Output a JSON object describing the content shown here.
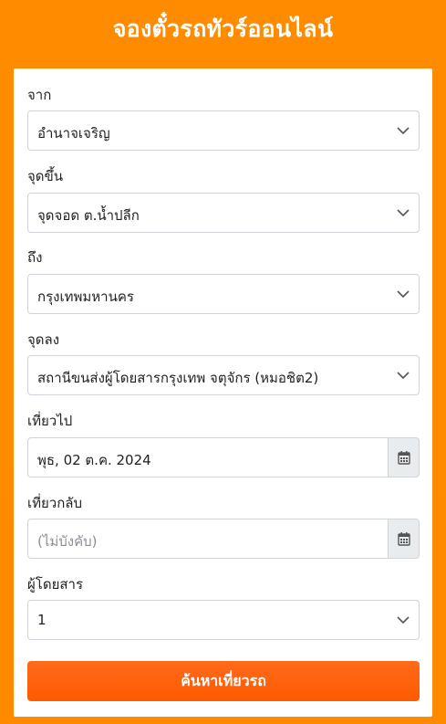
{
  "header": {
    "title": "จองตั๋วรถทัวร์ออนไลน์"
  },
  "form": {
    "from": {
      "label": "จาก",
      "value": "อำนาจเจริญ"
    },
    "pickup": {
      "label": "จุดขึ้น",
      "value": "จุดจอด ต.น้ำปลีก"
    },
    "to": {
      "label": "ถึง",
      "value": "กรุงเทพมหานคร"
    },
    "dropoff": {
      "label": "จุดลง",
      "value": "สถานีขนส่งผู้โดยสารกรุงเทพ จตุจักร (หมอชิต2)"
    },
    "depart": {
      "label": "เที่ยวไป",
      "value": "พุธ, 02 ต.ค. 2024"
    },
    "return": {
      "label": "เที่ยวกลับ",
      "placeholder": "(ไม่บังคับ)"
    },
    "passengers": {
      "label": "ผู้โดยสาร",
      "value": "1"
    },
    "search_label": "ค้นหาเที่ยวรถ"
  },
  "icons": {
    "dropdown": "chevron-down-icon",
    "calendar": "calendar-icon"
  },
  "colors": {
    "background": "#ff8c00",
    "button": "#ff5f0a",
    "addon": "#e9ecef"
  }
}
